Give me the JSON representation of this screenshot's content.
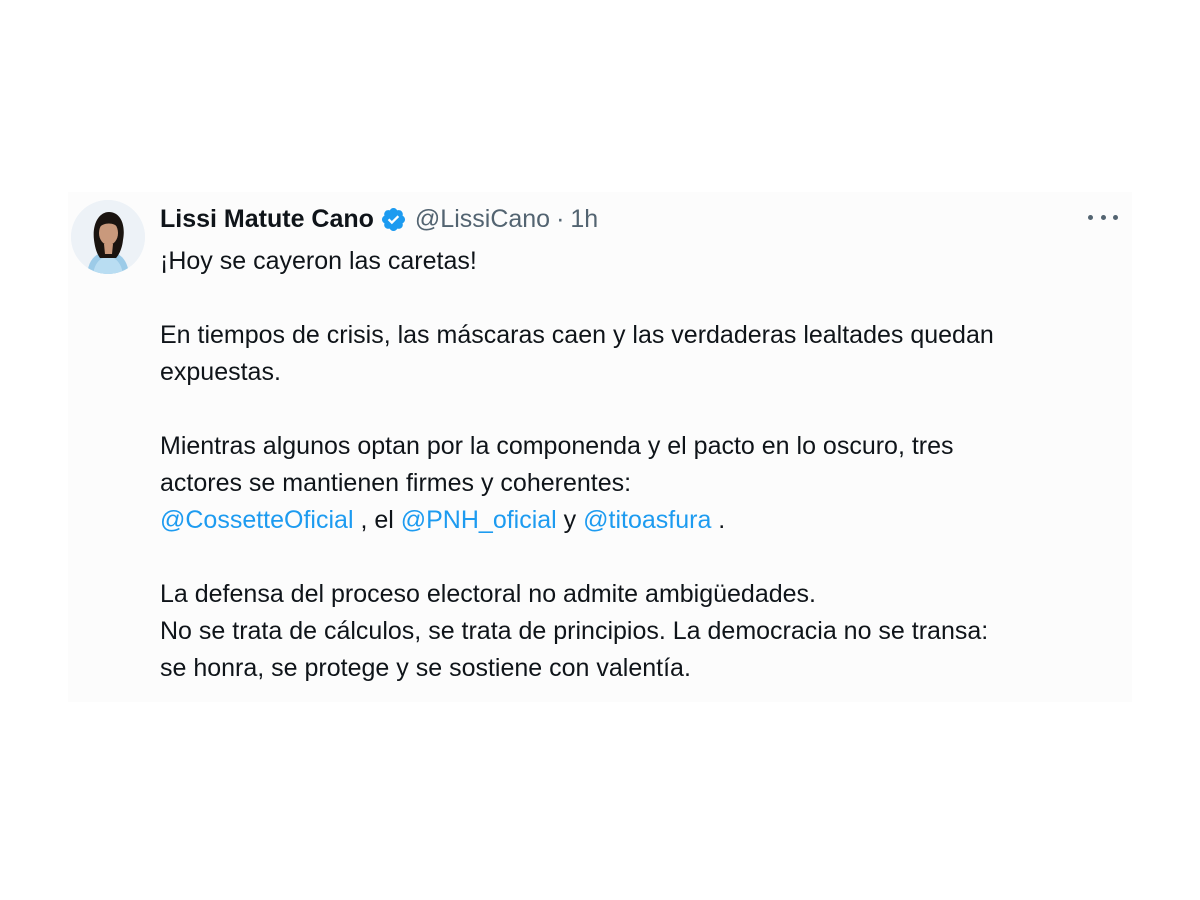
{
  "tweet": {
    "display_name": "Lissi Matute Cano",
    "verified_icon": "verified-badge-icon",
    "handle": "@LissiCano",
    "separator": "·",
    "time": "1h",
    "more_icon": "more-options-icon",
    "avatar_icon": "profile-photo",
    "paragraph_1": "¡Hoy se cayeron las caretas!",
    "paragraph_2_line_1": "En tiempos de crisis, las máscaras caen y las verdaderas lealtades quedan",
    "paragraph_2_line_2": "expuestas.",
    "paragraph_3_line_1": "Mientras algunos optan por la componenda y el pacto en lo oscuro, tres",
    "paragraph_3_line_2": "actores se mantienen firmes y coherentes:",
    "mention_1": "@CossetteOficial",
    "text_between_1": " , el ",
    "mention_2": "@PNH_oficial",
    "text_between_2": " y ",
    "mention_3": "@titoasfura",
    "text_end": " .",
    "paragraph_4_line_1": "La defensa del proceso electoral no admite ambigüedades.",
    "paragraph_4_line_2": "No se trata de cálculos, se trata de principios. La democracia no se transa:",
    "paragraph_4_line_3": "se honra, se protege y se sostiene con valentía."
  },
  "colors": {
    "text": "#0f1419",
    "secondary": "#536471",
    "accent": "#1d9bf0"
  }
}
